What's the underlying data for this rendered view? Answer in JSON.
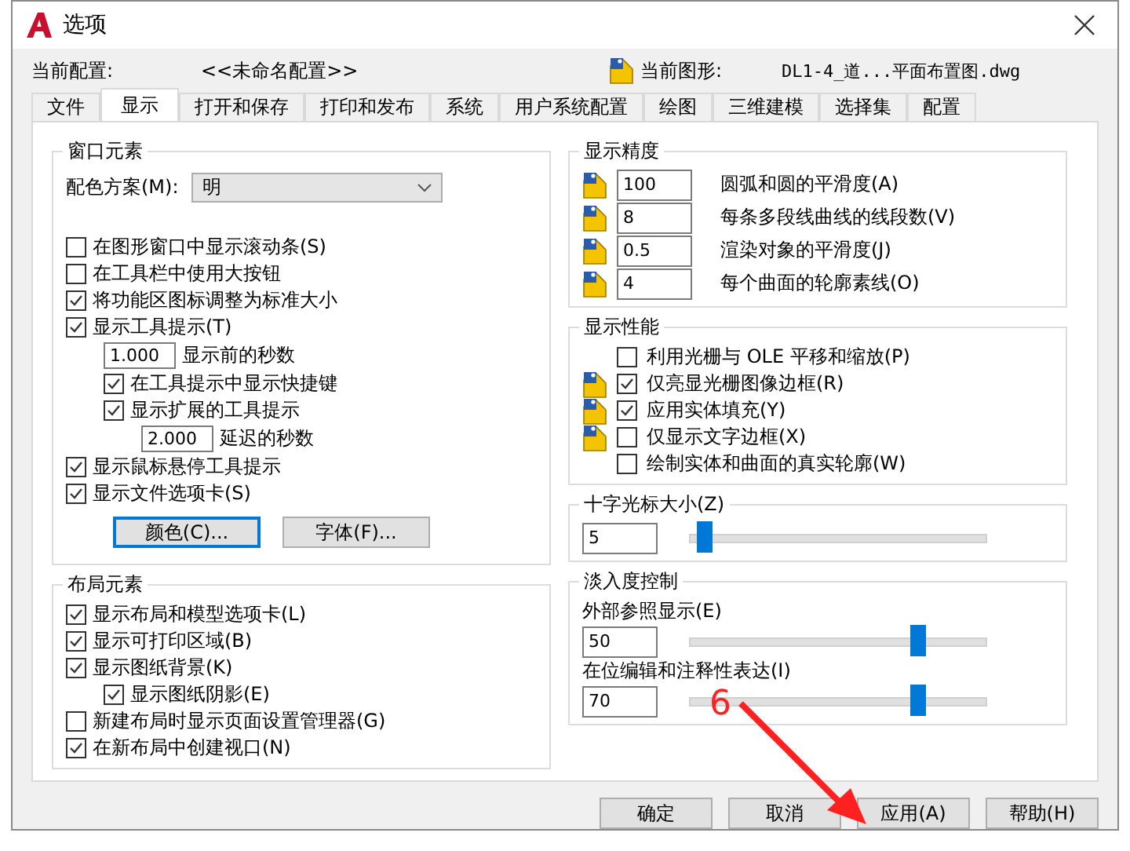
{
  "window": {
    "title": "选项"
  },
  "header": {
    "profile_label": "当前配置:",
    "profile": "<<未命名配置>>",
    "drawing_label": "当前图形:",
    "drawing": "DL1-4_道...平面布置图.dwg"
  },
  "tabs": [
    {
      "label": "文件",
      "selected": false
    },
    {
      "label": "显示",
      "selected": true
    },
    {
      "label": "打开和保存",
      "selected": false
    },
    {
      "label": "打印和发布",
      "selected": false
    },
    {
      "label": "系统",
      "selected": false
    },
    {
      "label": "用户系统配置",
      "selected": false
    },
    {
      "label": "绘图",
      "selected": false
    },
    {
      "label": "三维建模",
      "selected": false
    },
    {
      "label": "选择集",
      "selected": false
    },
    {
      "label": "配置",
      "selected": false
    }
  ],
  "window_elements": {
    "title": "窗口元素",
    "color_scheme": {
      "label": "配色方案(M):",
      "value": "明"
    },
    "items": [
      {
        "kind": "checkbox",
        "label": "在图形窗口中显示滚动条(S)",
        "checked": false
      },
      {
        "kind": "checkbox",
        "label": "在工具栏中使用大按钮",
        "checked": false
      },
      {
        "kind": "checkbox",
        "label": "将功能区图标调整为标准大小",
        "checked": true
      },
      {
        "kind": "checkbox",
        "label": "显示工具提示(T)",
        "checked": true,
        "children": [
          {
            "kind": "number",
            "value": "1.000",
            "label": "显示前的秒数"
          },
          {
            "kind": "checkbox",
            "label": "在工具提示中显示快捷键",
            "checked": true
          },
          {
            "kind": "checkbox",
            "label": "显示扩展的工具提示",
            "checked": true,
            "children": [
              {
                "kind": "number",
                "value": "2.000",
                "label": "延迟的秒数"
              }
            ]
          }
        ]
      },
      {
        "kind": "checkbox",
        "label": "显示鼠标悬停工具提示",
        "checked": true
      },
      {
        "kind": "checkbox",
        "label": "显示文件选项卡(S)",
        "checked": true
      }
    ],
    "buttons": [
      {
        "label": "颜色(C)...",
        "focused": true
      },
      {
        "label": "字体(F)...",
        "focused": false
      }
    ]
  },
  "layout_elements": {
    "title": "布局元素",
    "items": [
      {
        "kind": "checkbox",
        "label": "显示布局和模型选项卡(L)",
        "checked": true
      },
      {
        "kind": "checkbox",
        "label": "显示可打印区域(B)",
        "checked": true
      },
      {
        "kind": "checkbox",
        "label": "显示图纸背景(K)",
        "checked": true,
        "children": [
          {
            "kind": "checkbox",
            "label": "显示图纸阴影(E)",
            "checked": true
          }
        ]
      },
      {
        "kind": "checkbox",
        "label": "新建布局时显示页面设置管理器(G)",
        "checked": false
      },
      {
        "kind": "checkbox",
        "label": "在新布局中创建视口(N)",
        "checked": true
      }
    ]
  },
  "display_resolution": {
    "title": "显示精度",
    "items": [
      {
        "value": "100",
        "label": "圆弧和圆的平滑度(A)"
      },
      {
        "value": "8",
        "label": "每条多段线曲线的线段数(V)"
      },
      {
        "value": "0.5",
        "label": "渲染对象的平滑度(J)"
      },
      {
        "value": "4",
        "label": "每个曲面的轮廓素线(O)"
      }
    ]
  },
  "display_performance": {
    "title": "显示性能",
    "items": [
      {
        "label": "利用光栅与 OLE 平移和缩放(P)",
        "checked": false,
        "saved_in_drawing": false
      },
      {
        "label": "仅亮显光栅图像边框(R)",
        "checked": true,
        "saved_in_drawing": true
      },
      {
        "label": "应用实体填充(Y)",
        "checked": true,
        "saved_in_drawing": true
      },
      {
        "label": "仅显示文字边框(X)",
        "checked": false,
        "saved_in_drawing": true
      },
      {
        "label": "绘制实体和曲面的真实轮廓(W)",
        "checked": false,
        "saved_in_drawing": false
      }
    ]
  },
  "crosshair_size": {
    "title": "十字光标大小(Z)",
    "value": "5",
    "level": 0.05
  },
  "fade_control": {
    "title": "淡入度控制",
    "items": [
      {
        "label": "外部参照显示(E)",
        "value": "50",
        "level": 0.77
      },
      {
        "label": "在位编辑和注释性表达(I)",
        "value": "70",
        "level": 0.77
      }
    ]
  },
  "buttons": [
    {
      "label": "确定"
    },
    {
      "label": "取消"
    },
    {
      "label": "应用(A)"
    },
    {
      "label": "帮助(H)"
    }
  ],
  "annotation": {
    "label": "6"
  }
}
